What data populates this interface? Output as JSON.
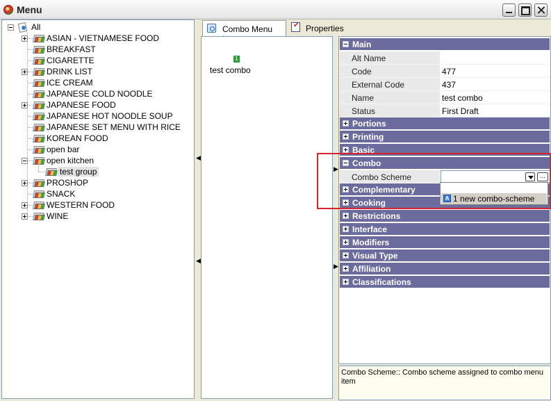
{
  "window": {
    "title": "Menu"
  },
  "tree": {
    "root": "All",
    "items": [
      {
        "label": "ASIAN - VIETNAMESE FOOD",
        "expandable": true
      },
      {
        "label": "BREAKFAST",
        "expandable": false
      },
      {
        "label": "CIGARETTE",
        "expandable": false
      },
      {
        "label": "DRINK LIST",
        "expandable": true
      },
      {
        "label": "ICE CREAM",
        "expandable": false
      },
      {
        "label": "JAPANESE COLD NOODLE",
        "expandable": false
      },
      {
        "label": "JAPANESE FOOD",
        "expandable": true
      },
      {
        "label": "JAPANESE HOT NOODLE SOUP",
        "expandable": false
      },
      {
        "label": "JAPANESE SET MENU WITH RICE",
        "expandable": false
      },
      {
        "label": "KOREAN FOOD",
        "expandable": false
      },
      {
        "label": "open bar",
        "expandable": false
      },
      {
        "label": "open kitchen",
        "expandable": true,
        "expanded": true
      },
      {
        "label": "test group",
        "child": true,
        "selected": true
      },
      {
        "label": "PROSHOP",
        "expandable": true
      },
      {
        "label": "SNACK",
        "expandable": false
      },
      {
        "label": "WESTERN FOOD",
        "expandable": true
      },
      {
        "label": "WINE",
        "expandable": true
      }
    ]
  },
  "tabs": [
    {
      "label": "Combo Menu Items",
      "active": true
    },
    {
      "label": "Properties",
      "active": false
    }
  ],
  "combo_items": [
    {
      "label": "test combo",
      "badge": "1"
    }
  ],
  "properties": {
    "main": {
      "title": "Main",
      "rows": [
        {
          "name": "Alt Name",
          "value": ""
        },
        {
          "name": "Code",
          "value": "477"
        },
        {
          "name": "External Code",
          "value": "437"
        },
        {
          "name": "Name",
          "value": "test combo"
        },
        {
          "name": "Status",
          "value": "First Draft"
        }
      ]
    },
    "collapsed_before": [
      "Portions",
      "Printing",
      "Basic"
    ],
    "combo": {
      "title": "Combo",
      "row_name": "Combo Scheme",
      "value": "",
      "more_button": "...",
      "dropdown_option": "1 new combo-scheme",
      "dropdown_icon": "A"
    },
    "collapsed_after": [
      "Complementary",
      "Cooking",
      "Restrictions",
      "Interface",
      "Modifiers",
      "Visual Type",
      "Affiliation",
      "Classifications"
    ]
  },
  "help_text": "Combo Scheme:: Combo scheme assigned to combo menu item"
}
